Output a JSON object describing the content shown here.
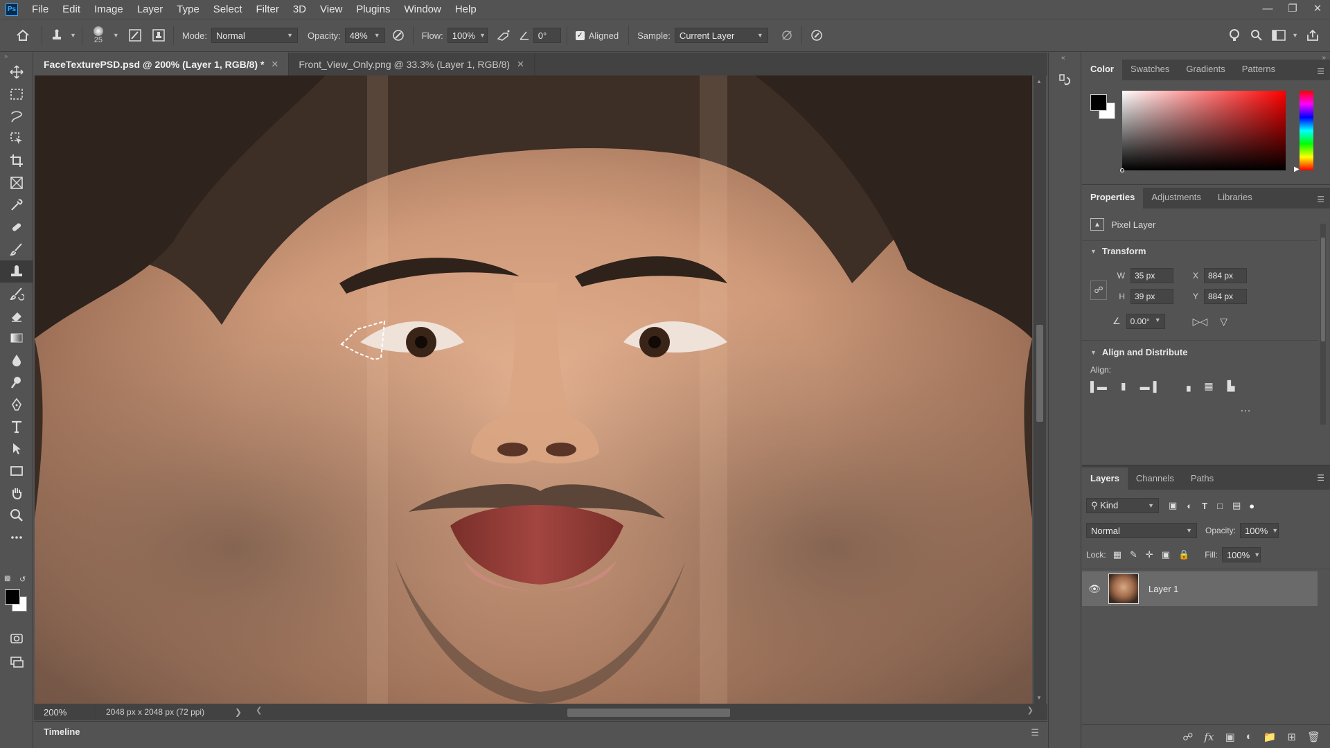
{
  "menu": {
    "logo": "Ps",
    "items": [
      "File",
      "Edit",
      "Image",
      "Layer",
      "Type",
      "Select",
      "Filter",
      "3D",
      "View",
      "Plugins",
      "Window",
      "Help"
    ]
  },
  "options": {
    "brush_size": "25",
    "mode_label": "Mode:",
    "mode_value": "Normal",
    "opacity_label": "Opacity:",
    "opacity_value": "48%",
    "flow_label": "Flow:",
    "flow_value": "100%",
    "angle_value": "0°",
    "aligned_label": "Aligned",
    "aligned_checked": true,
    "sample_label": "Sample:",
    "sample_value": "Current Layer"
  },
  "tabs": [
    {
      "label": "FaceTexturePSD.psd @ 200% (Layer 1, RGB/8) *",
      "active": true
    },
    {
      "label": "Front_View_Only.png @ 33.3% (Layer 1, RGB/8)",
      "active": false
    }
  ],
  "status": {
    "zoom": "200%",
    "doc_info": "2048 px x 2048 px (72 ppi)"
  },
  "timeline": {
    "title": "Timeline"
  },
  "color_panel": {
    "tabs": [
      "Color",
      "Swatches",
      "Gradients",
      "Patterns"
    ],
    "foreground": "#000000",
    "background": "#ffffff",
    "hue": "#ff0000"
  },
  "properties_panel": {
    "tabs": [
      "Properties",
      "Adjustments",
      "Libraries"
    ],
    "kind": "Pixel Layer",
    "transform_title": "Transform",
    "w_label": "W",
    "w_value": "35 px",
    "h_label": "H",
    "h_value": "39 px",
    "x_label": "X",
    "x_value": "884 px",
    "y_label": "Y",
    "y_value": "884 px",
    "angle_value": "0.00°",
    "align_title": "Align and Distribute",
    "align_label": "Align:"
  },
  "layers_panel": {
    "tabs": [
      "Layers",
      "Channels",
      "Paths"
    ],
    "filter_kind": "Kind",
    "blend_mode": "Normal",
    "opacity_label": "Opacity:",
    "opacity_value": "100%",
    "lock_label": "Lock:",
    "fill_label": "Fill:",
    "fill_value": "100%",
    "layers": [
      {
        "name": "Layer 1",
        "visible": true,
        "selected": true
      }
    ]
  },
  "icons": {
    "home": "home-icon",
    "stamp": "clone-stamp-icon",
    "brush_preset": "brush-preset-icon",
    "search": "search-icon",
    "share": "share-icon"
  }
}
